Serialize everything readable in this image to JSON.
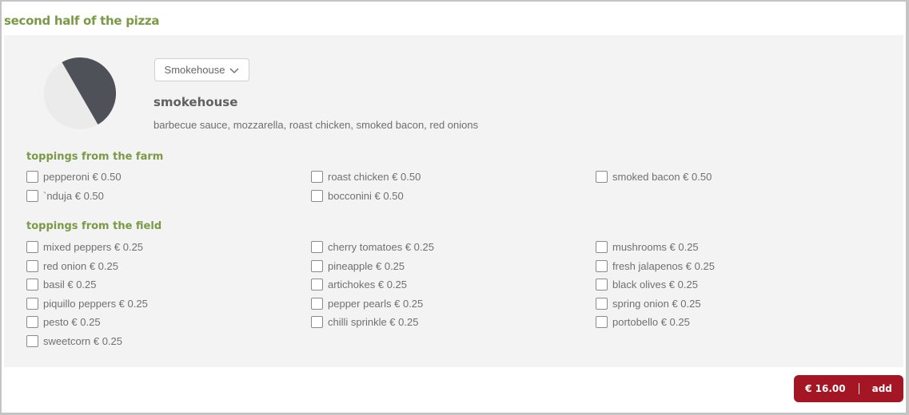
{
  "section": {
    "title": "second half of the pizza"
  },
  "pizza": {
    "selector": {
      "value": "Smokehouse",
      "icon": "chevron-down-icon"
    },
    "name": "smokehouse",
    "description": "barbecue sauce, mozzarella, roast chicken, smoked bacon, red onions",
    "half_indicator": {
      "selected_half": "second",
      "colors": {
        "selected": "#4f5159",
        "unselected": "#ebebeb"
      }
    }
  },
  "toppings": {
    "farm": {
      "title": "toppings from the farm",
      "items": [
        {
          "label": "pepperoni € 0.50",
          "checked": false
        },
        {
          "label": "roast chicken € 0.50",
          "checked": false
        },
        {
          "label": "smoked bacon € 0.50",
          "checked": false
        },
        {
          "label": "`nduja € 0.50",
          "checked": false
        },
        {
          "label": "bocconini € 0.50",
          "checked": false
        }
      ]
    },
    "field": {
      "title": "toppings from the field",
      "items": [
        {
          "label": "mixed peppers € 0.25",
          "checked": false
        },
        {
          "label": "cherry tomatoes € 0.25",
          "checked": false
        },
        {
          "label": "mushrooms € 0.25",
          "checked": false
        },
        {
          "label": "red onion € 0.25",
          "checked": false
        },
        {
          "label": "pineapple € 0.25",
          "checked": false
        },
        {
          "label": "fresh jalapenos € 0.25",
          "checked": false
        },
        {
          "label": "basil € 0.25",
          "checked": false
        },
        {
          "label": "artichokes € 0.25",
          "checked": false
        },
        {
          "label": "black olives € 0.25",
          "checked": false
        },
        {
          "label": "piquillo peppers € 0.25",
          "checked": false
        },
        {
          "label": "pepper pearls € 0.25",
          "checked": false
        },
        {
          "label": "spring onion € 0.25",
          "checked": false
        },
        {
          "label": "pesto € 0.25",
          "checked": false
        },
        {
          "label": "chilli sprinkle € 0.25",
          "checked": false
        },
        {
          "label": "portobello € 0.25",
          "checked": false
        },
        {
          "label": "sweetcorn € 0.25",
          "checked": false
        }
      ]
    }
  },
  "footer": {
    "price": "€ 16.00",
    "add_label": "add",
    "button_color": "#a41623"
  },
  "colors": {
    "accent_green": "#7a9a45"
  }
}
